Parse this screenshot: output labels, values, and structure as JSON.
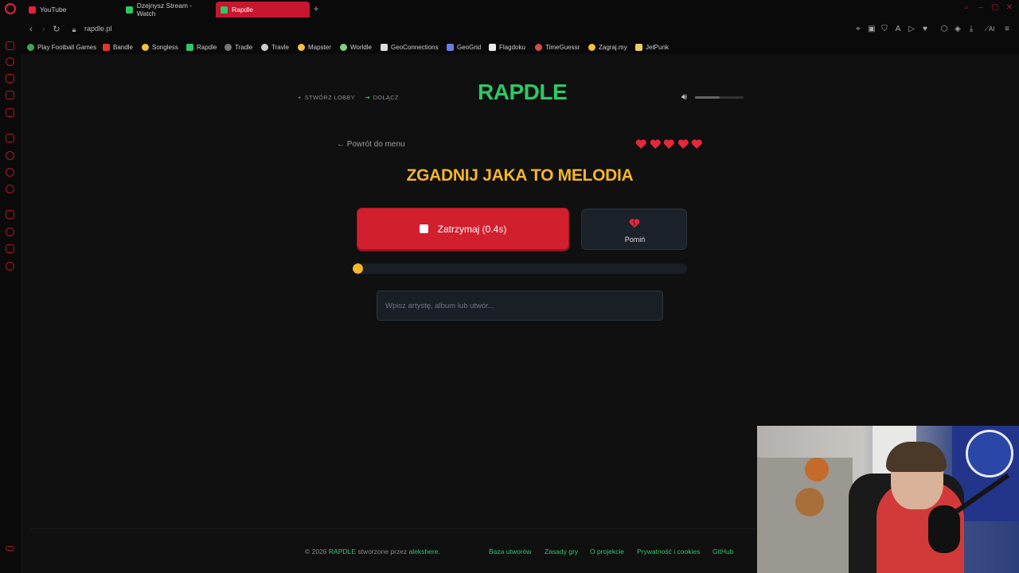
{
  "browser": {
    "tabs": [
      {
        "label": "YouTube",
        "color": "#e0223a"
      },
      {
        "label": "Dzejnysz Stream - Watch",
        "color": "#2ec866"
      },
      {
        "label": "Rapdle",
        "color": "#2ec866",
        "active": true
      }
    ],
    "url": "rapdle.pl",
    "bookmarks": [
      {
        "label": "Play Football Games",
        "color": "#3aa655"
      },
      {
        "label": "Bandle",
        "color": "#d83b2a"
      },
      {
        "label": "Songless",
        "color": "#f2c230"
      },
      {
        "label": "Rapdle",
        "color": "#2ec866"
      },
      {
        "label": "Tradle",
        "color": "#777777"
      },
      {
        "label": "Travle",
        "color": "#cccccc"
      },
      {
        "label": "Mapster",
        "color": "#f5c03a"
      },
      {
        "label": "Worldle",
        "color": "#7fd07f"
      },
      {
        "label": "GeoConnections",
        "color": "#dddddd"
      },
      {
        "label": "GeoGrid",
        "color": "#6a7de0"
      },
      {
        "label": "Flagdoku",
        "color": "#eeeeee"
      },
      {
        "label": "TimeGuessr",
        "color": "#d84a4a"
      },
      {
        "label": "Zagraj.my",
        "color": "#f5c03a"
      },
      {
        "label": "JetPunk",
        "color": "#e6d25a"
      }
    ]
  },
  "game": {
    "create_lobby": "STWÓRZ LOBBY",
    "join": "DOŁĄCZ",
    "logo": "RAPDLE",
    "volume": 0.5,
    "back": "← Powrót do menu",
    "lives": 5,
    "heading": "ZGADNIJ JAKA TO MELODIA",
    "stop_button": "Zatrzymaj (0.4s)",
    "skip_button": "Pomiń",
    "progress": 0.02,
    "search_placeholder": "Wpisz artystę, album lub utwór..."
  },
  "footer": {
    "copyright_prefix": "© 2026",
    "brand": "RAPDLE",
    "made_by": "stworzone przez",
    "author": "alekshere.",
    "links": [
      "Baza utworów",
      "Zasady gry",
      "O projekcie",
      "Prywatność i cookies",
      "GitHub"
    ]
  },
  "colors": {
    "accent_green": "#2ec866",
    "accent_yellow": "#f5b62a",
    "stop_red": "#d21f2e",
    "heart_red": "#e5283a"
  }
}
